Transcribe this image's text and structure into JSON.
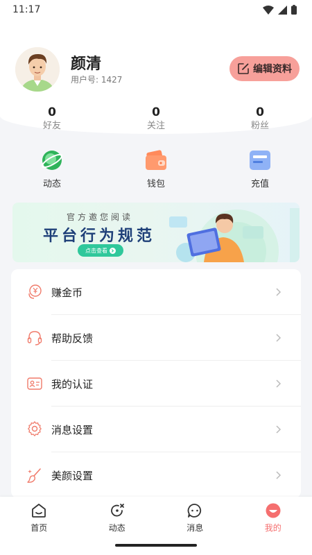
{
  "status_bar": {
    "time": "11:17"
  },
  "profile": {
    "name": "颜清",
    "user_id_label": "用户号:",
    "user_id": "1427",
    "edit_button": "编辑资料"
  },
  "stats": [
    {
      "value": "0",
      "label": "好友"
    },
    {
      "value": "0",
      "label": "关注"
    },
    {
      "value": "0",
      "label": "粉丝"
    }
  ],
  "shortcuts": [
    {
      "label": "动态",
      "icon": "planet-icon"
    },
    {
      "label": "钱包",
      "icon": "wallet-icon"
    },
    {
      "label": "充值",
      "icon": "card-icon"
    }
  ],
  "banner": {
    "subtitle": "官方邀您阅读",
    "title": "平台行为规范",
    "button": "点击查看"
  },
  "menu": [
    {
      "label": "赚金币",
      "icon": "coin-icon"
    },
    {
      "label": "帮助反馈",
      "icon": "headset-icon"
    },
    {
      "label": "我的认证",
      "icon": "id-card-icon"
    },
    {
      "label": "消息设置",
      "icon": "gear-icon"
    },
    {
      "label": "美颜设置",
      "icon": "brush-icon"
    }
  ],
  "bottom_nav": [
    {
      "label": "首页",
      "icon": "home-icon",
      "active": false
    },
    {
      "label": "动态",
      "icon": "refresh-icon",
      "active": false
    },
    {
      "label": "消息",
      "icon": "chat-icon",
      "active": false
    },
    {
      "label": "我的",
      "icon": "profile-face-icon",
      "active": true
    }
  ],
  "colors": {
    "accent": "#f56f6f",
    "edit_button_bg": "#f7a09a",
    "banner_title": "#1e3f78",
    "banner_button": "#2fc89b"
  }
}
